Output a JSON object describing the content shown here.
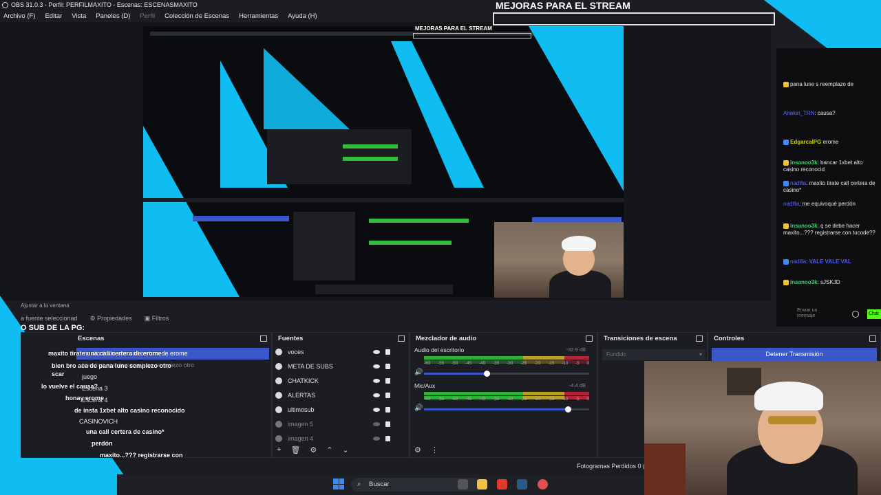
{
  "window": {
    "title": "OBS 31.0.3 - Perfil: PERFILMAXITO - Escenas: ESCENASMAXITO",
    "menu": [
      "Archivo (F)",
      "Editar",
      "Vista",
      "Paneles (D)",
      "Perfil",
      "Colección de Escenas",
      "Herramientas",
      "Ayuda (H)"
    ]
  },
  "overlay": {
    "banner": "MEJORAS PARA EL STREAM",
    "banner_small": "MEJORAS PARA EL STREAM",
    "sub_text": "O SUB DE LA PG:"
  },
  "preview": {
    "fit_label": "Ajustar a la ventana",
    "no_source": "a fuente seleccionad",
    "properties": "Propiedades",
    "filters": "Filtros"
  },
  "chat": {
    "messages": [
      {
        "text": "pana lune s reemplazo de"
      },
      {
        "user": "Anakin_TRN",
        "text": "causa?"
      },
      {
        "user": "EdgarcalPG",
        "text": "erome"
      },
      {
        "user": "insanoo3k",
        "text": "bancar 1xbet alto casino reconocid"
      },
      {
        "user": "nadilla",
        "text": "maxito tirate call certera de casino*"
      },
      {
        "user": "nadilla",
        "text": "me equivoqué perdón"
      },
      {
        "user": "insanoo3k",
        "text": "q se debe hacer maxito...??? registrarse con tucode??"
      },
      {
        "user": "nadilla",
        "text": "VALE VALE VAL"
      },
      {
        "user": "insanoo3k",
        "text": "sJSKJD"
      }
    ],
    "send": "Enviar un mensaje",
    "chat_btn": "Chat"
  },
  "docks": {
    "scenes": {
      "title": "Escenas",
      "items": [
        "maxito tirate una call certera de erome",
        "bien bro aca de pana lune sempiezo otro",
        "juego",
        "Escena 3",
        "Escena 4"
      ],
      "overlay_chat": [
        "maxito tirate una call certera de erome",
        "bien bro aca de pana lune sempiezo otro",
        "scar",
        "lo vuelve el causa?",
        "honay erome",
        "de insta 1xbet alto casino reconocido",
        "CASINOVICH",
        "una call certera de casino*",
        "perdón",
        "maxito...??? registrarse con"
      ]
    },
    "sources": {
      "title": "Fuentes",
      "items": [
        {
          "label": "voces",
          "dim": false
        },
        {
          "label": "META DE SUBS",
          "dim": false
        },
        {
          "label": "CHATKICK",
          "dim": false
        },
        {
          "label": "ALERTAS",
          "dim": false
        },
        {
          "label": "ultimosub",
          "dim": false
        },
        {
          "label": "imagen 5",
          "dim": true
        },
        {
          "label": "imagen 4",
          "dim": true
        }
      ]
    },
    "mixer": {
      "title": "Mezclador de audio",
      "channels": [
        {
          "name": "Audio del escritorio",
          "db": "-32.9 dB",
          "level": 0.38
        },
        {
          "name": "Mic/Aux",
          "db": "-4.4 dB",
          "level": 0.87
        }
      ],
      "ticks": [
        "-60",
        "-55",
        "-50",
        "-45",
        "-40",
        "-35",
        "-30",
        "-25",
        "-20",
        "-15",
        "-10",
        "-5",
        "0"
      ]
    },
    "transitions": {
      "title": "Transiciones de escena",
      "selected": "Fundido"
    },
    "controls": {
      "title": "Controles",
      "stop": "Detener Transmisión"
    }
  },
  "status": {
    "dropped": "Fotogramas Perdidos 0 ("
  },
  "taskbar": {
    "search": "Buscar"
  }
}
